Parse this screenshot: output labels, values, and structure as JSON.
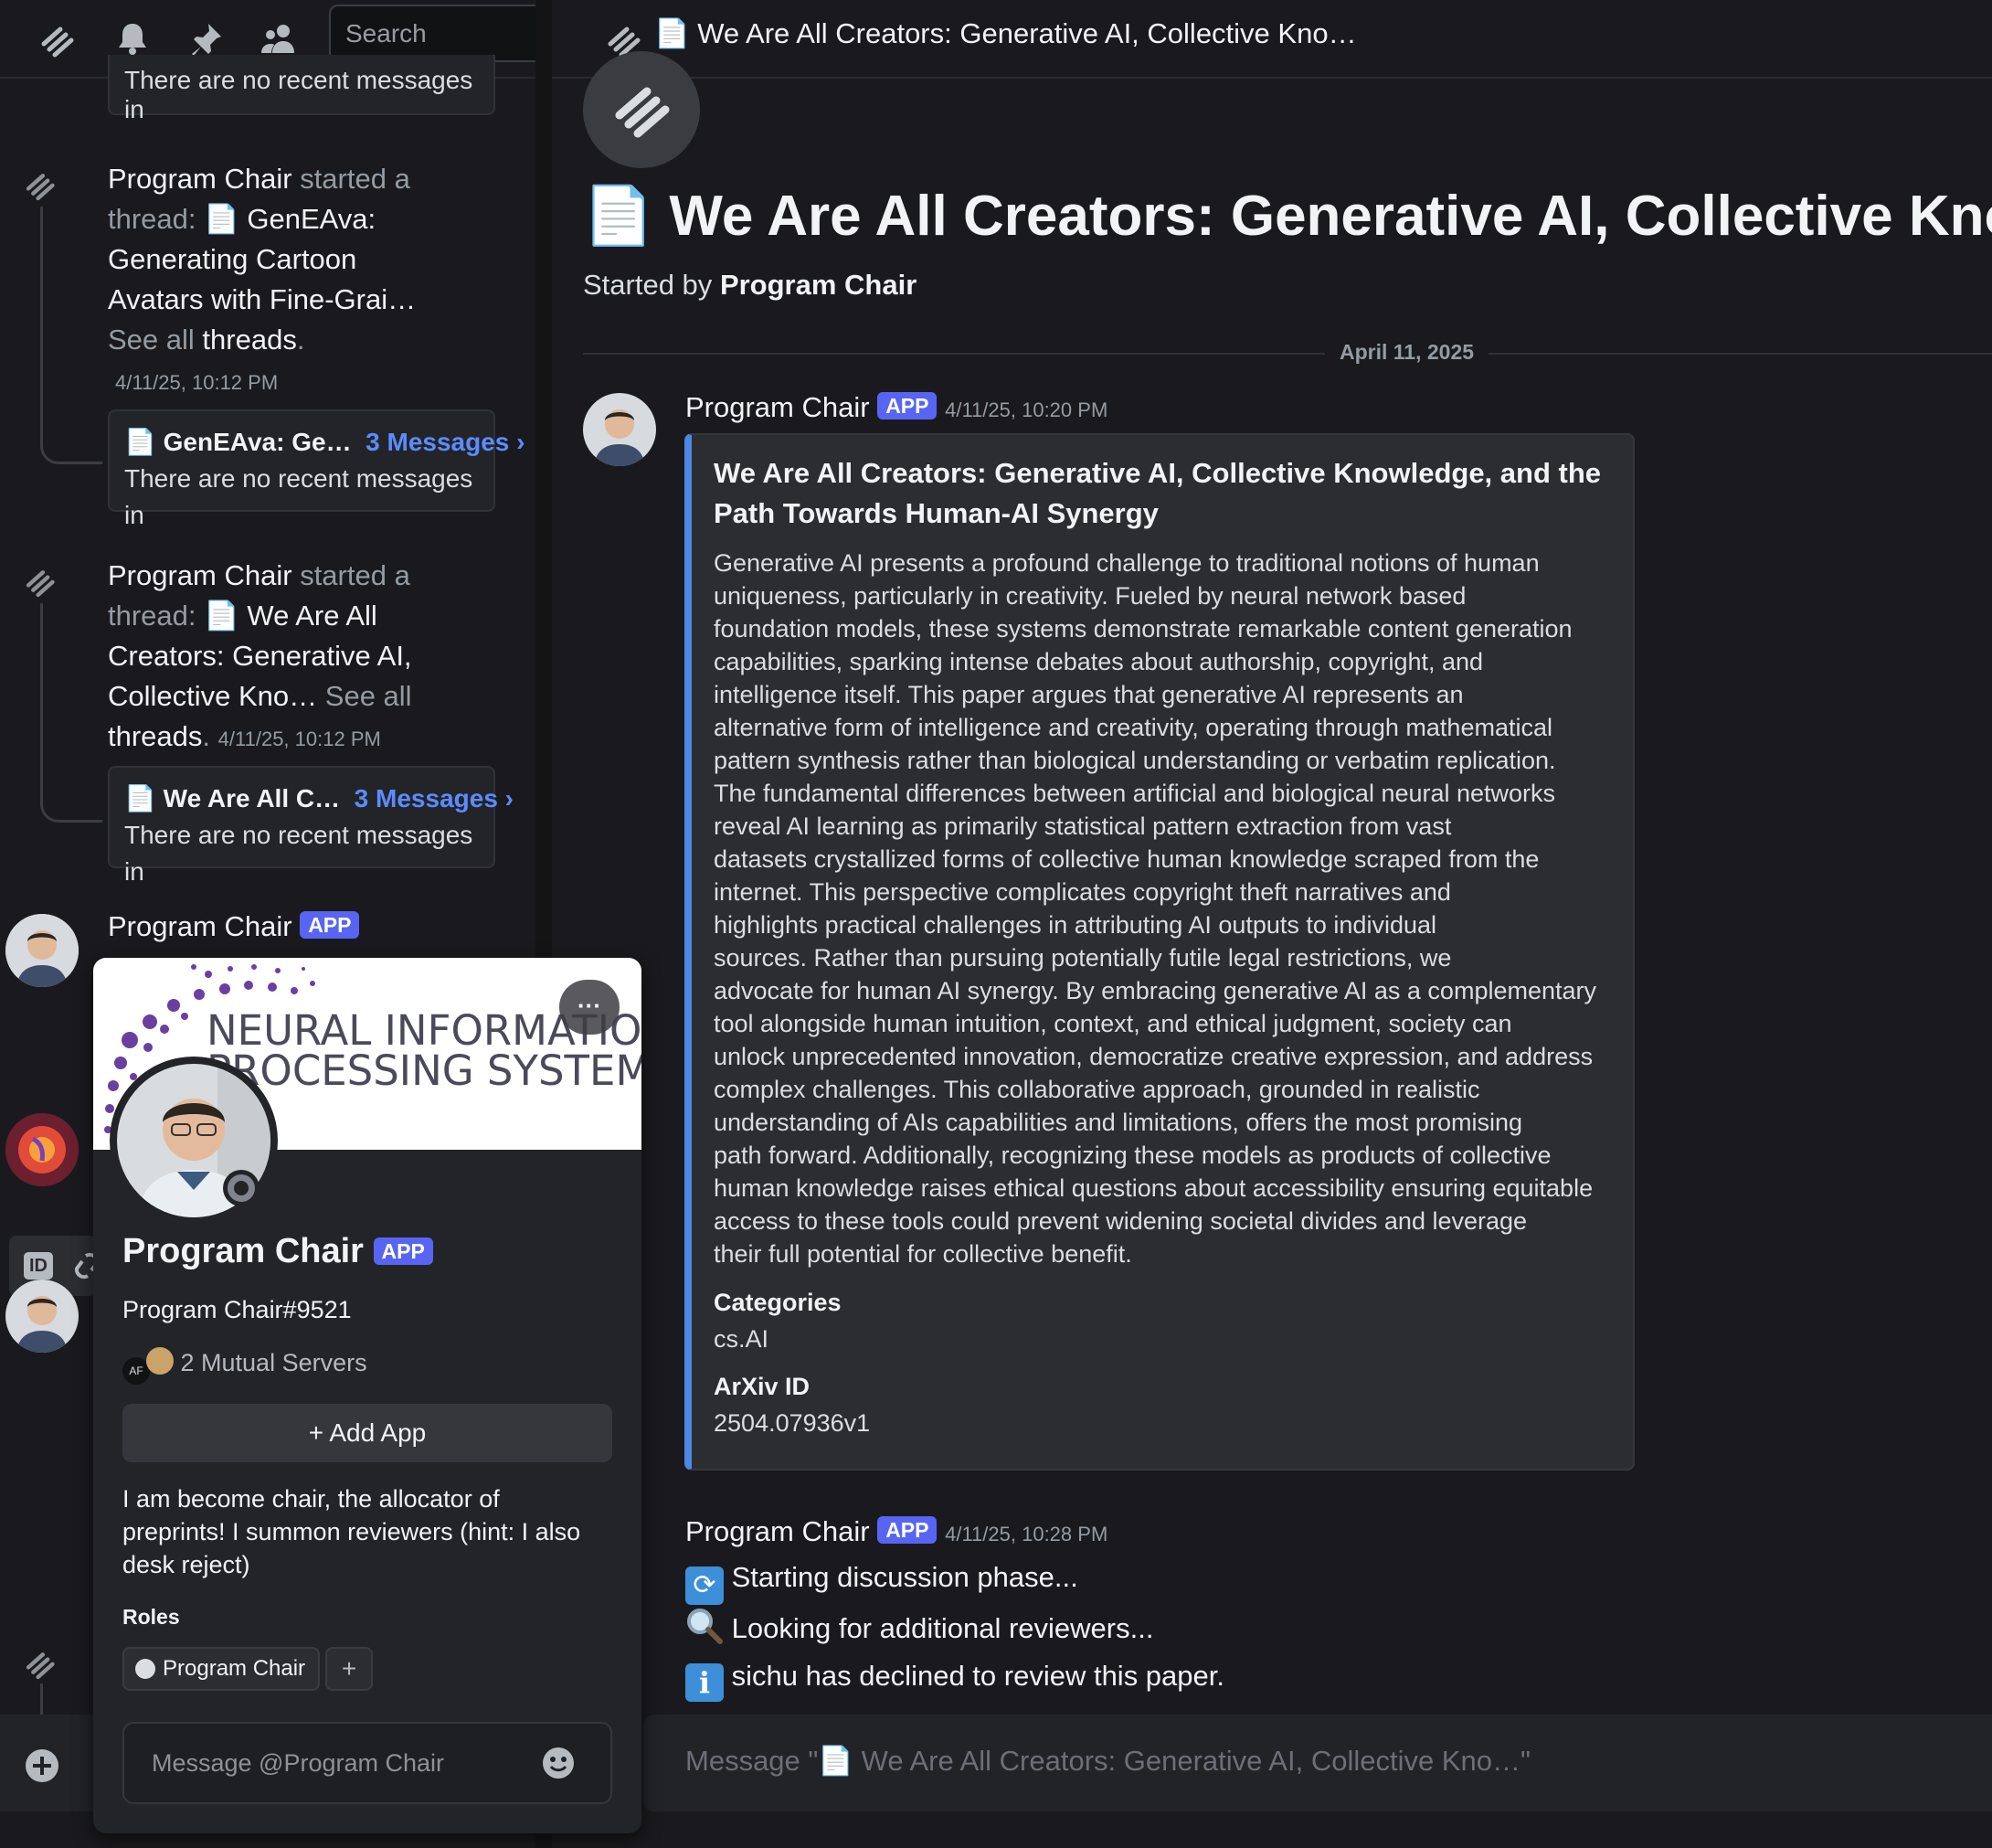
{
  "left": {
    "search_placeholder": "Search",
    "top_card_text": "There are no recent messages in",
    "thread1": {
      "author": "Program Chair",
      "started": "started a thread:",
      "doc_emoji": "📄",
      "title": "GenEAva: Generating Cartoon Avatars with Fine-Grai…",
      "see_all": "See all",
      "threads": "threads",
      "timestamp": "4/11/25, 10:12 PM",
      "card_title": "GenEAva: Ge…",
      "card_count": "3 Messages ›",
      "card_text": "There are no recent messages in"
    },
    "thread2": {
      "author": "Program Chair",
      "started": "started a thread:",
      "doc_emoji": "📄",
      "title": "We Are All Creators: Generative AI, Collective Kno…",
      "see_all": "See all",
      "threads": "threads",
      "timestamp": "4/11/25, 10:12 PM",
      "card_title": "We Are All C…",
      "card_count": "3 Messages ›",
      "card_text": "There are no recent messages in"
    },
    "msg_author": "Program Chair",
    "app_badge": "APP",
    "id_badge": "ID"
  },
  "popup": {
    "banner_line1": "NEURAL INFORMATION",
    "banner_line2": "PROCESSING SYSTEMS",
    "more_label": "···",
    "name": "Program Chair",
    "app_badge": "APP",
    "username": "Program Chair#9521",
    "mutual_icon_text": "AF",
    "mutual_servers": "2 Mutual Servers",
    "add_app": "Add App",
    "bio": "I am become chair, the allocator of preprints! I summon reviewers (hint: I also desk reject)",
    "roles_heading": "Roles",
    "role_name": "Program Chair",
    "role_add": "+",
    "message_placeholder": "Message @Program Chair"
  },
  "right": {
    "header_title": "📄 We Are All Creators: Generative AI, Collective Kno…",
    "thread_title": "📄 We Are All Creators: Generative AI, Collective Kno…",
    "started_by_prefix": "Started by",
    "started_by_name": "Program Chair",
    "date_divider": "April 11, 2025",
    "msg1": {
      "author": "Program Chair",
      "app_badge": "APP",
      "timestamp": "4/11/25, 10:20 PM",
      "embed_title_line1": "We Are All Creators: Generative AI, Collective Knowledge, and the",
      "embed_title_line2": "Path Towards Human-AI Synergy",
      "abstract_lines": [
        "Generative AI presents a profound challenge to traditional notions of human",
        "uniqueness, particularly in creativity. Fueled by neural network based",
        "foundation models, these systems demonstrate remarkable content generation",
        "capabilities, sparking intense debates about authorship, copyright, and",
        "intelligence itself. This paper argues that generative AI represents an",
        "alternative form of intelligence and creativity, operating through mathematical",
        "pattern synthesis rather than biological understanding or verbatim replication.",
        "The fundamental differences between artificial and biological neural networks",
        "reveal AI learning as primarily statistical pattern extraction from vast",
        "datasets crystallized forms of collective human knowledge scraped from the",
        "internet. This perspective complicates copyright theft narratives and",
        "highlights practical challenges in attributing AI outputs to individual",
        "sources. Rather than pursuing potentially futile legal restrictions, we",
        "advocate for human AI synergy. By embracing generative AI as a complementary",
        "tool alongside human intuition, context, and ethical judgment, society can",
        "unlock unprecedented innovation, democratize creative expression, and address",
        "complex challenges. This collaborative approach, grounded in realistic",
        "understanding of AIs capabilities and limitations, offers the most promising",
        "path forward. Additionally, recognizing these models as products of collective",
        "human knowledge raises ethical questions about accessibility ensuring equitable",
        "access to these tools could prevent widening societal divides and leverage",
        "their full potential for collective benefit."
      ],
      "field1_name": "Categories",
      "field1_value": "cs.AI",
      "field2_name": "ArXiv ID",
      "field2_value": "2504.07936v1"
    },
    "msg2": {
      "author": "Program Chair",
      "app_badge": "APP",
      "timestamp": "4/11/25, 10:28 PM",
      "line1": "Starting discussion phase...",
      "line2": "Looking for additional reviewers...",
      "line3": "sichu has declined to review this paper."
    },
    "composer_placeholder": "Message \"📄 We Are All Creators: Generative AI, Collective Kno…\""
  },
  "colors": {
    "background": "#1a1a1e",
    "app_badge": "#5865f2",
    "link_blue": "#5b8cff",
    "embed_bar": "#4e86e4"
  },
  "icons": [
    "threads-icon",
    "bell-icon",
    "pin-icon",
    "members-icon",
    "plus-circle-icon",
    "emoji-icon",
    "refresh-emoji-icon",
    "magnifier-emoji-icon",
    "info-emoji-icon"
  ]
}
